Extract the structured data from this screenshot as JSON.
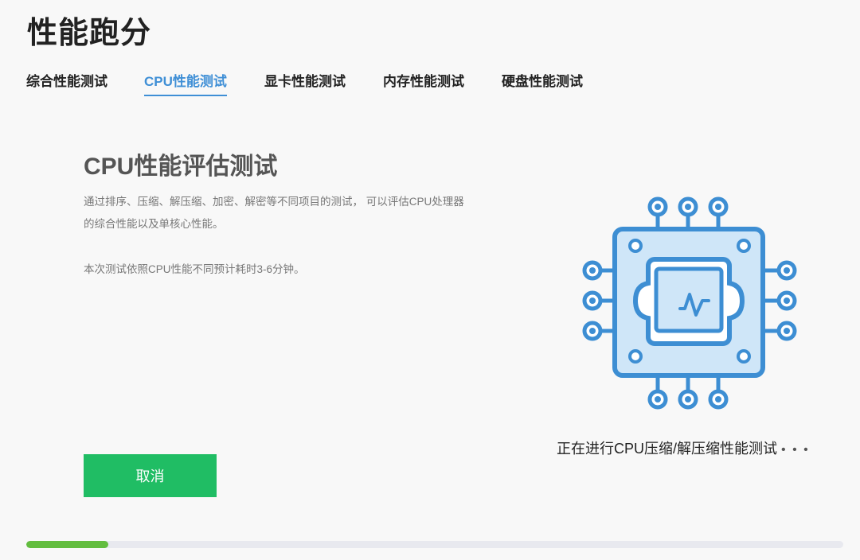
{
  "page": {
    "title": "性能跑分"
  },
  "tabs": [
    {
      "label": "综合性能测试",
      "active": false
    },
    {
      "label": "CPU性能测试",
      "active": true
    },
    {
      "label": "显卡性能测试",
      "active": false
    },
    {
      "label": "内存性能测试",
      "active": false
    },
    {
      "label": "硬盘性能测试",
      "active": false
    }
  ],
  "main": {
    "title": "CPU性能评估测试",
    "description": "通过排序、压缩、解压缩、加密、解密等不同项目的测试， 可以评估CPU处理器的综合性能以及单核心性能。",
    "note": "本次测试依照CPU性能不同预计耗时3-6分钟。",
    "cancel_label": "取消",
    "status_text": "正在进行CPU压缩/解压缩性能测试",
    "status_dots": "• • •",
    "chip_icon": "cpu-chip-icon"
  },
  "progress": {
    "fraction": 0.1
  },
  "colors": {
    "accent": "#3f8fd6",
    "button": "#20bd64",
    "progress": "#63bd3f",
    "chip_outline": "#3d8ed3",
    "chip_fill": "#cfe6f8"
  }
}
